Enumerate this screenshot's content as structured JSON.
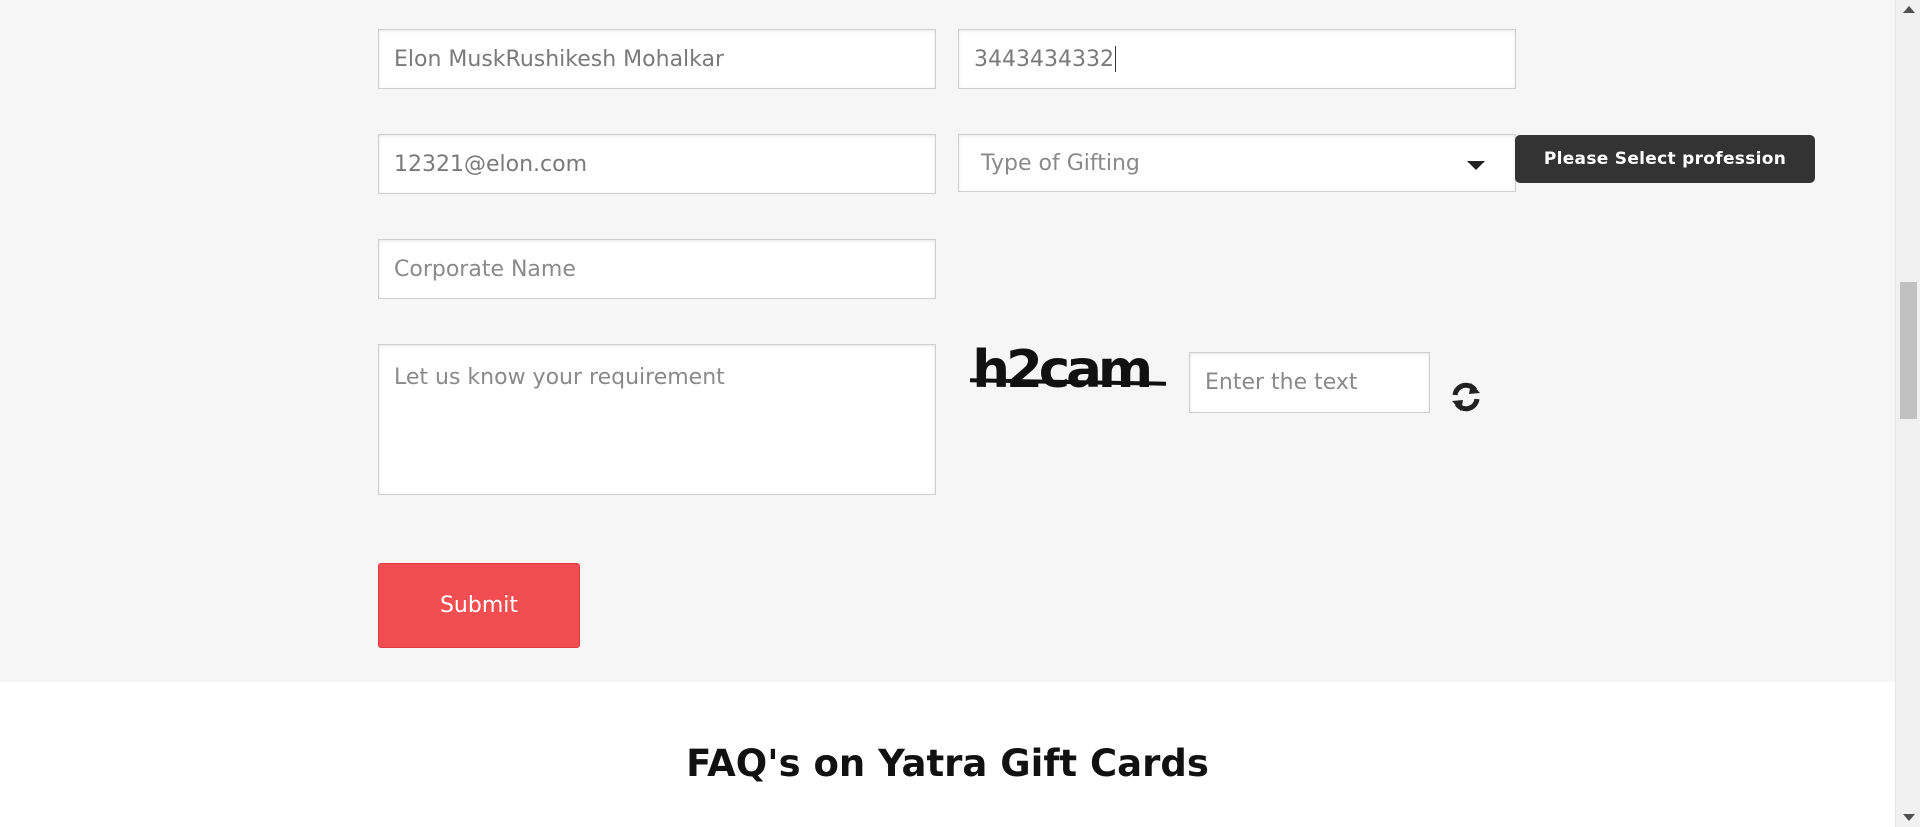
{
  "form": {
    "name_value": "Elon MuskRushikesh Mohalkar",
    "phone_value": "3443434332",
    "email_value": "12321@elon.com",
    "gifting_type_placeholder": "Type of Gifting",
    "corporate_name_placeholder": "Corporate Name",
    "requirement_placeholder": "Let us know your requirement",
    "captcha_text": "h2cam",
    "captcha_input_placeholder": "Enter the text",
    "submit_label": "Submit"
  },
  "tooltip": {
    "message": "Please Select profession"
  },
  "faq": {
    "title": "FAQ's on Yatra Gift Cards"
  },
  "colors": {
    "submit_bg": "#f24e51",
    "tooltip_bg": "#333333",
    "section_bg": "#f6f6f6"
  },
  "icons": {
    "refresh": "refresh-icon",
    "dropdown": "chevron-down-icon"
  }
}
